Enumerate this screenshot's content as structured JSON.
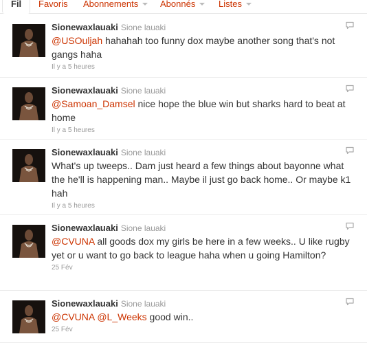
{
  "tabs": [
    {
      "label": "Fil",
      "has_caret": false,
      "active": true
    },
    {
      "label": "Favoris",
      "has_caret": false,
      "active": false
    },
    {
      "label": "Abonnements",
      "has_caret": true,
      "active": false
    },
    {
      "label": "Abonnés",
      "has_caret": true,
      "active": false
    },
    {
      "label": "Listes",
      "has_caret": true,
      "active": false
    }
  ],
  "tweets": [
    {
      "screen_name": "Sionewaxlauaki",
      "full_name": "Sione lauaki",
      "text_parts": [
        {
          "text": "@USOuljah",
          "mention": true
        },
        {
          "text": " hahahah too funny dox maybe another song that's not gangs haha",
          "mention": false
        }
      ],
      "time": "Il y a 5 heures"
    },
    {
      "screen_name": "Sionewaxlauaki",
      "full_name": "Sione lauaki",
      "text_parts": [
        {
          "text": "@Samoan_Damsel",
          "mention": true
        },
        {
          "text": " nice hope the blue win but sharks hard to beat at home",
          "mention": false
        }
      ],
      "time": "Il y a 5 heures"
    },
    {
      "screen_name": "Sionewaxlauaki",
      "full_name": "Sione lauaki",
      "text_parts": [
        {
          "text": "What's up tweeps.. Dam just heard a few things about bayonne what the he'll is happening man.. Maybe il just go back home.. Or maybe k1 hah",
          "mention": false
        }
      ],
      "time": "Il y a 5 heures"
    },
    {
      "screen_name": "Sionewaxlauaki",
      "full_name": "Sione lauaki",
      "text_parts": [
        {
          "text": "@CVUNA",
          "mention": true
        },
        {
          "text": " all goods dox my girls be here in a few weeks.. U like rugby yet or u want to go back to league haha when u going Hamilton?",
          "mention": false
        }
      ],
      "time": "25 Fév"
    },
    {
      "screen_name": "Sionewaxlauaki",
      "full_name": "Sione lauaki",
      "text_parts": [
        {
          "text": "@CVUNA",
          "mention": true
        },
        {
          "text": " ",
          "mention": false
        },
        {
          "text": "@L_Weeks",
          "mention": true
        },
        {
          "text": " good win..",
          "mention": false
        }
      ],
      "time": "25 Fév"
    }
  ],
  "icons": {
    "reply": "reply-icon",
    "avatar": "avatar"
  },
  "colors": {
    "link": "#cc3300",
    "meta": "#999999",
    "text": "#333333"
  }
}
